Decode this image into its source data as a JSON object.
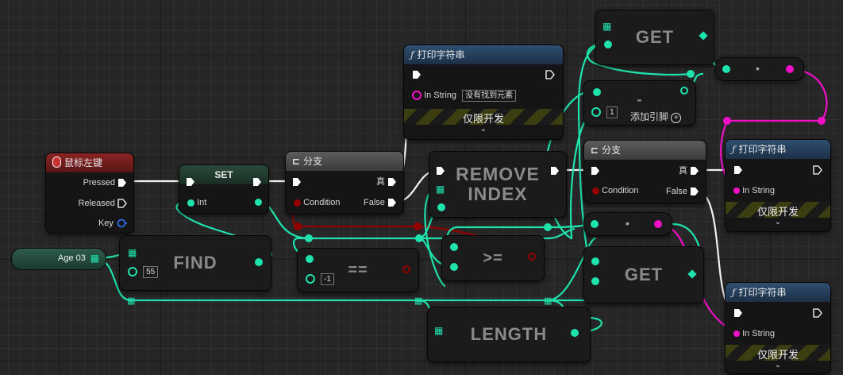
{
  "colors": {
    "background": "#262626",
    "node_body": "#151515",
    "exec_wire": "#ffffff",
    "int_wire": "#1fe3ad",
    "string_wire": "#f10fc7",
    "bool_wire": "#930000",
    "function_header": "#2f4f71",
    "event_header": "#8c2424",
    "branch_header": "#5c5c5c"
  },
  "event": {
    "title": "鼠标左键",
    "pins": [
      "Pressed",
      "Released",
      "Key"
    ],
    "icon": "mouse-icon",
    "key_icon": "key-icon"
  },
  "set_node": {
    "title": "SET",
    "input_label": "Int"
  },
  "branch1": {
    "title": "分支",
    "condition": "Condition",
    "true_label": "真",
    "false_label": "False",
    "icon": "branch-icon"
  },
  "branch2": {
    "title": "分支",
    "condition": "Condition",
    "true_label": "真",
    "false_label": "False",
    "icon": "branch-icon"
  },
  "print1": {
    "title": "打印字符串",
    "in_string": "In String",
    "in_string_value": "没有找到元素",
    "dev_only": "仅限开发",
    "expand": "⌄"
  },
  "print2": {
    "title": "打印字符串",
    "in_string": "In String",
    "dev_only": "仅限开发",
    "expand": "⌄"
  },
  "print3": {
    "title": "打印字符串",
    "in_string": "In String",
    "dev_only": "仅限开发",
    "expand": "⌄"
  },
  "function_icon": "ƒ",
  "variable": {
    "label": "Age 03"
  },
  "find": {
    "label": "FIND",
    "literal": "55"
  },
  "equals": {
    "label": "==",
    "literal": "-1"
  },
  "gte": {
    "label": ">="
  },
  "remove": {
    "label": "REMOVE\nINDEX"
  },
  "length": {
    "label": "LENGTH"
  },
  "get_top": {
    "label": "GET"
  },
  "get_bottom": {
    "label": "GET"
  },
  "subtract": {
    "label": "-",
    "literal": "1",
    "add_pin": "添加引脚"
  },
  "reroute_top": {
    "label": "•"
  },
  "reroute_mid": {
    "label": "•"
  }
}
